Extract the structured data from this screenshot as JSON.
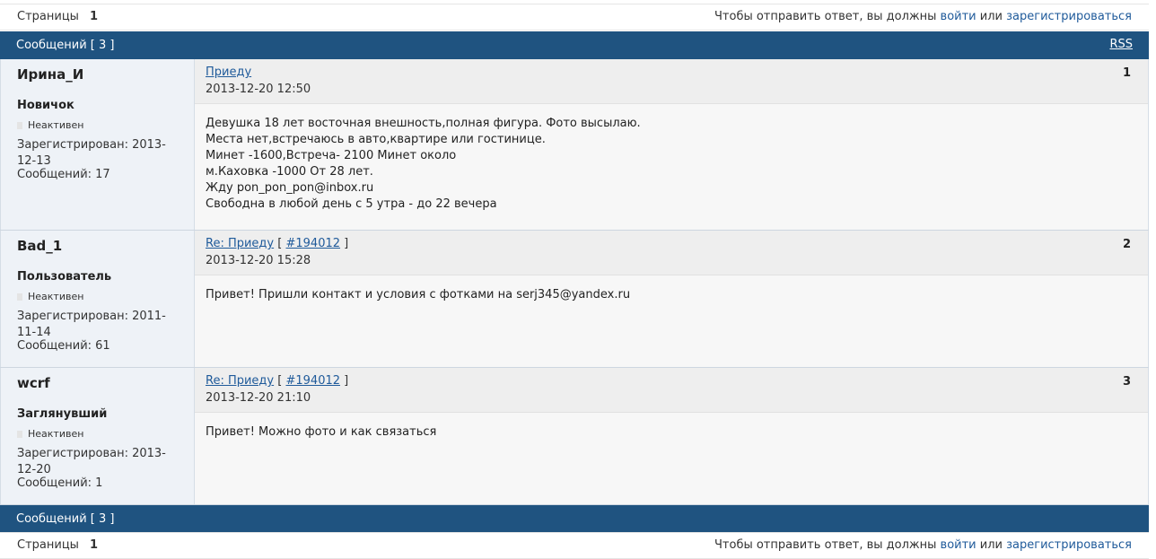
{
  "top_bar": {
    "pages_label": "Страницы",
    "page_number": "1",
    "notice": "Чтобы отправить ответ, вы должны",
    "login_link": "войти",
    "or_text": "или",
    "register_link": "зарегистрироваться"
  },
  "header": {
    "messages_label": "Сообщений [ 3 ]",
    "rss": "RSS"
  },
  "posts": [
    {
      "author": "Ирина_И",
      "rank": "Новичок",
      "status": "Неактивен",
      "registered": "Зарегистрирован: 2013-12-13",
      "messages": "Сообщений: 17",
      "subject": "Приеду",
      "ref_open": "",
      "ref": "",
      "ref_close": "",
      "date": "2013-12-20 12:50",
      "number": "1",
      "body": [
        "Девушка 18 лет восточная внешность,полная фигура. Фото высылаю.",
        "Места нет,встречаюсь в авто,квартире или гостинице.",
        "Минет -1600,Встреча- 2100 Минет около",
        "м.Каховка -1000 От 28 лет.",
        "Жду pon_pon_pon@inbox.ru",
        "Свободна в любой день с 5 утра - до 22 вечера"
      ]
    },
    {
      "author": "Bad_1",
      "rank": "Пользователь",
      "status": "Неактивен",
      "registered": "Зарегистрирован: 2011-11-14",
      "messages": "Сообщений: 61",
      "subject": "Re: Приеду",
      "ref_open": "[",
      "ref": "#194012",
      "ref_close": "]",
      "date": "2013-12-20 15:28",
      "number": "2",
      "body": [
        "Привет! Пришли контакт и условия с фотками на serj345@yandex.ru"
      ]
    },
    {
      "author": "wcrf",
      "rank": "Заглянувший",
      "status": "Неактивен",
      "registered": "Зарегистрирован: 2013-12-20",
      "messages": "Сообщений: 1",
      "subject": "Re: Приеду",
      "ref_open": "[",
      "ref": "#194012",
      "ref_close": "]",
      "date": "2013-12-20 21:10",
      "number": "3",
      "body": [
        "Привет! Можно фото и как связаться"
      ]
    }
  ],
  "footer": {
    "messages_label": "Сообщений [ 3 ]"
  }
}
